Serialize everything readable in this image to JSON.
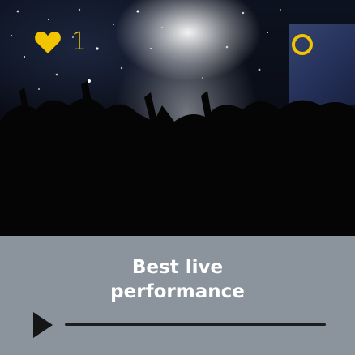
{
  "card": {
    "likes": {
      "icon": "heart-icon",
      "count": "1"
    },
    "status_icon": "ring-icon",
    "title_lines": [
      "Best live",
      "performance"
    ],
    "player": {
      "play_icon": "play-icon",
      "progress": 0
    }
  },
  "colors": {
    "accent": "#f2c500",
    "panel": "#8b949d",
    "title": "#ffffff",
    "controls": "#151515"
  }
}
